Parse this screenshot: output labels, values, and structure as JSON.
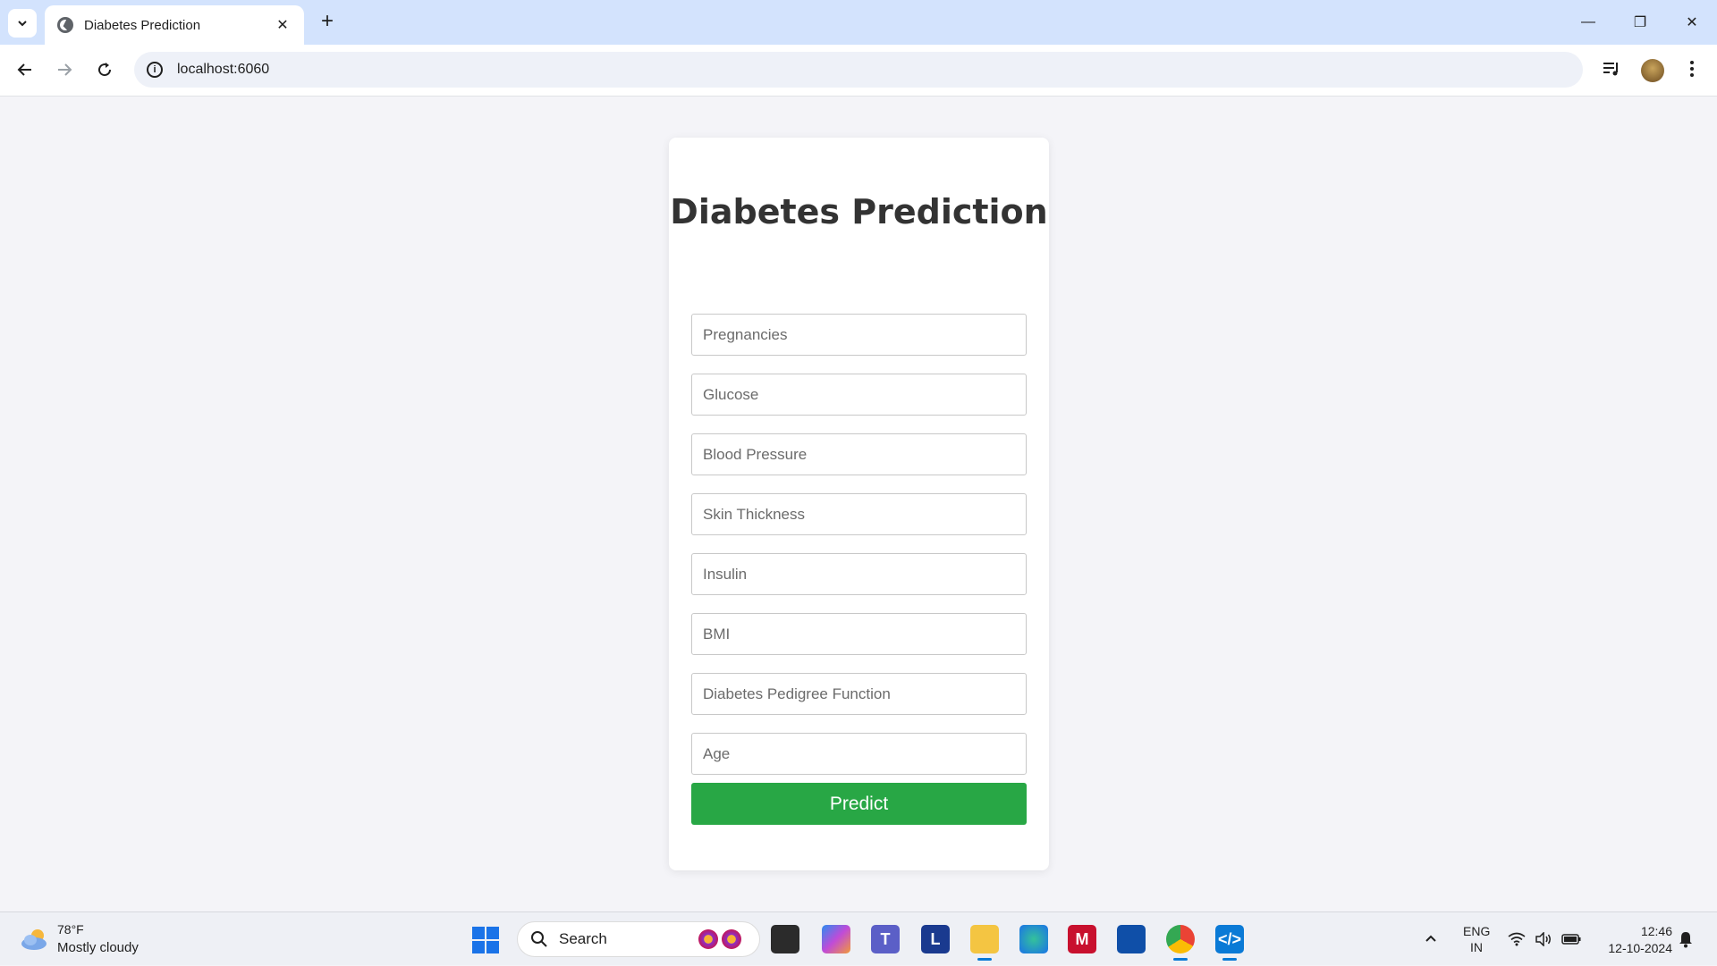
{
  "browser": {
    "tab_title": "Diabetes Prediction",
    "tab_close": "✕",
    "new_tab": "+",
    "url": "localhost:6060",
    "window_controls": {
      "minimize": "—",
      "restore": "❐",
      "close": "✕"
    }
  },
  "form": {
    "title": "Diabetes Prediction",
    "fields": [
      {
        "placeholder": "Pregnancies",
        "value": ""
      },
      {
        "placeholder": "Glucose",
        "value": ""
      },
      {
        "placeholder": "Blood Pressure",
        "value": ""
      },
      {
        "placeholder": "Skin Thickness",
        "value": ""
      },
      {
        "placeholder": "Insulin",
        "value": ""
      },
      {
        "placeholder": "BMI",
        "value": ""
      },
      {
        "placeholder": "Diabetes Pedigree Function",
        "value": ""
      },
      {
        "placeholder": "Age",
        "value": ""
      }
    ],
    "submit_label": "Predict",
    "submit_color": "#28a745"
  },
  "taskbar": {
    "weather_temp": "78°F",
    "weather_desc": "Mostly cloudy",
    "search_label": "Search",
    "apps": [
      "file-explorer-icon",
      "copilot-icon",
      "teams-icon",
      "l-app-icon",
      "folder-icon",
      "edge-icon",
      "mcafee-icon",
      "store-icon",
      "chrome-icon",
      "vscode-icon"
    ],
    "lang_line1": "ENG",
    "lang_line2": "IN",
    "time": "12:46",
    "date": "12-10-2024"
  }
}
